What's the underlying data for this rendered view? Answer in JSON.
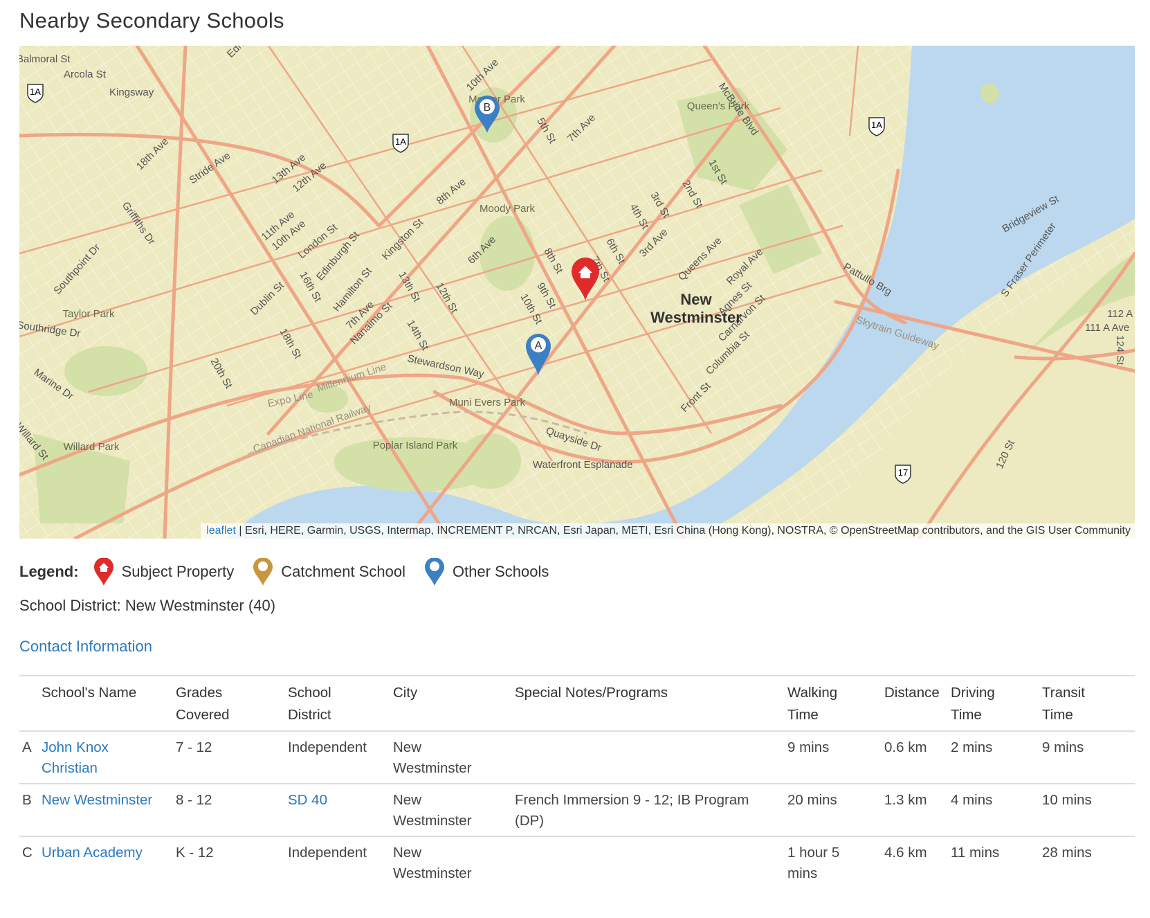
{
  "page": {
    "title": "Nearby Secondary Schools"
  },
  "map": {
    "attribution_link": "leaflet",
    "attribution_text": " | Esri, HERE, Garmin, USGS, Intermap, INCREMENT P, NRCAN, Esri Japan, METI, Esri China (Hong Kong), NOSTRA, © OpenStreetMap contributors, and the GIS User Community",
    "city_label_line1": "New",
    "city_label_line2": "Westminster",
    "markers": [
      {
        "letter": "A",
        "kind": "other",
        "color": "#3b7fc4"
      },
      {
        "letter": "B",
        "kind": "other",
        "color": "#3b7fc4"
      },
      {
        "letter": "",
        "kind": "subject",
        "color": "#e02b2b"
      }
    ],
    "shields": [
      "1A",
      "1A",
      "1A",
      "17"
    ],
    "labels": {
      "streets": [
        "Balmoral St",
        "Arcola St",
        "Kingsway",
        "18th Ave",
        "Stride Ave",
        "13th Ave",
        "12th Ave",
        "11th Ave",
        "10th Ave",
        "London St",
        "Griffiths Dr",
        "Southpoint Dr",
        "Southridge Dr",
        "Marine Dr",
        "Willard St",
        "Dublin St",
        "16th St",
        "Edinburgh St",
        "Kingston St",
        "Hamilton St",
        "13th St",
        "7th Ave",
        "Nanaimo St",
        "14th St",
        "18th St",
        "20th St",
        "12th St",
        "6th Ave",
        "8th Ave",
        "10th Ave",
        "5th St",
        "7th Ave",
        "McBride Blvd",
        "1st St",
        "2nd St",
        "3rd St",
        "4th St",
        "3rd Ave",
        "6th St",
        "7th St",
        "8th St",
        "9th St",
        "10th St",
        "Queens Ave",
        "Royal Ave",
        "Agnes St",
        "Carnarvon St",
        "Columbia St",
        "Front St",
        "Stewardson Way",
        "Quayside Dr",
        "Waterfront Esplanade",
        "Pattullo Brg",
        "Bridgeview St",
        "S Fraser Perimeter",
        "112 A",
        "111 A Ave",
        "124 St",
        "120 St",
        "Expo Line",
        "Millennium Line",
        "Canadian National Railway",
        "Skytrain Guideway",
        "Edmonds"
      ],
      "parks": [
        "Mercer Park",
        "Moody Park",
        "Queen's Park",
        "Taylor Park",
        "Willard Park",
        "Muni Evers Park",
        "Poplar Island Park"
      ]
    },
    "colors": {
      "land": "#ede9c0",
      "water": "#bcd8ee",
      "park": "#d3e0a8",
      "road": "#eea687",
      "street": "#ffffff"
    }
  },
  "legend": {
    "label": "Legend:",
    "items": [
      {
        "label": "Subject Property",
        "color": "#e02b2b",
        "icon": "house-marker-icon"
      },
      {
        "label": "Catchment School",
        "color": "#c8963e",
        "icon": "marker-icon"
      },
      {
        "label": "Other Schools",
        "color": "#3b7fc4",
        "icon": "marker-icon"
      }
    ]
  },
  "district": {
    "prefix": "School District: ",
    "value": "New Westminster (40)"
  },
  "contact": {
    "label": "Contact Information"
  },
  "table": {
    "headers": {
      "name": "School's Name",
      "grades_1": "Grades",
      "grades_2": "Covered",
      "district_1": "School",
      "district_2": "District",
      "city": "City",
      "notes": "Special Notes/Programs",
      "walking_1": "Walking",
      "walking_2": "Time",
      "distance": "Distance",
      "driving_1": "Driving",
      "driving_2": "Time",
      "transit_1": "Transit",
      "transit_2": "Time"
    },
    "rows": [
      {
        "letter": "A",
        "name": "John Knox Christian",
        "grades": "7 - 12",
        "district": "Independent",
        "city": "New Westminster",
        "notes": "",
        "walking": "9 mins",
        "distance": "0.6 km",
        "driving": "2 mins",
        "transit": "9 mins"
      },
      {
        "letter": "B",
        "name": "New Westminster",
        "grades": "8 - 12",
        "district": "SD 40",
        "city": "New Westminster",
        "notes": "French Immersion 9 - 12; IB Program (DP)",
        "walking": "20 mins",
        "distance": "1.3 km",
        "driving": "4 mins",
        "transit": "10 mins"
      },
      {
        "letter": "C",
        "name": "Urban Academy",
        "grades": "K - 12",
        "district": "Independent",
        "city": "New Westminster",
        "notes": "",
        "walking": "1 hour 5 mins",
        "distance": "4.6 km",
        "driving": "11 mins",
        "transit": "28 mins"
      }
    ]
  }
}
